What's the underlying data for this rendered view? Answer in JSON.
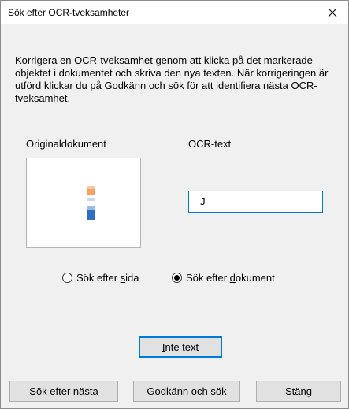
{
  "window": {
    "title": "Sök efter OCR-tveksamheter",
    "close_icon": "close-icon"
  },
  "instructions": "Korrigera en OCR-tveksamhet genom att klicka på det markerade objektet i dokumentet och skriva den nya texten. När korrigeringen är utförd klickar du på Godkänn och sök för att identifiera nästa OCR-tveksamhet.",
  "labels": {
    "original": "Originaldokument",
    "ocr_text": "OCR-text"
  },
  "ocr_input": {
    "value": "J"
  },
  "search_scope": {
    "options": [
      {
        "pre": "Sök efter ",
        "mnemonic": "s",
        "post": "ida",
        "selected": false
      },
      {
        "pre": "Sök efter ",
        "mnemonic": "d",
        "post": "okument",
        "selected": true
      }
    ]
  },
  "buttons": {
    "not_text": {
      "pre": "",
      "mnemonic": "I",
      "post": "nte text"
    },
    "find_next": {
      "pre": "S",
      "mnemonic": "ö",
      "post": "k efter nästa"
    },
    "approve_search": {
      "pre": "",
      "mnemonic": "G",
      "post": "odkänn och sök"
    },
    "close": {
      "pre": "St",
      "mnemonic": "ä",
      "post": "ng"
    }
  },
  "colors": {
    "dialog_bg": "#f0f0f0",
    "focus_blue": "#0078d7",
    "snippet_orange": "#f4a460",
    "snippet_blue": "#2f6fc0"
  }
}
